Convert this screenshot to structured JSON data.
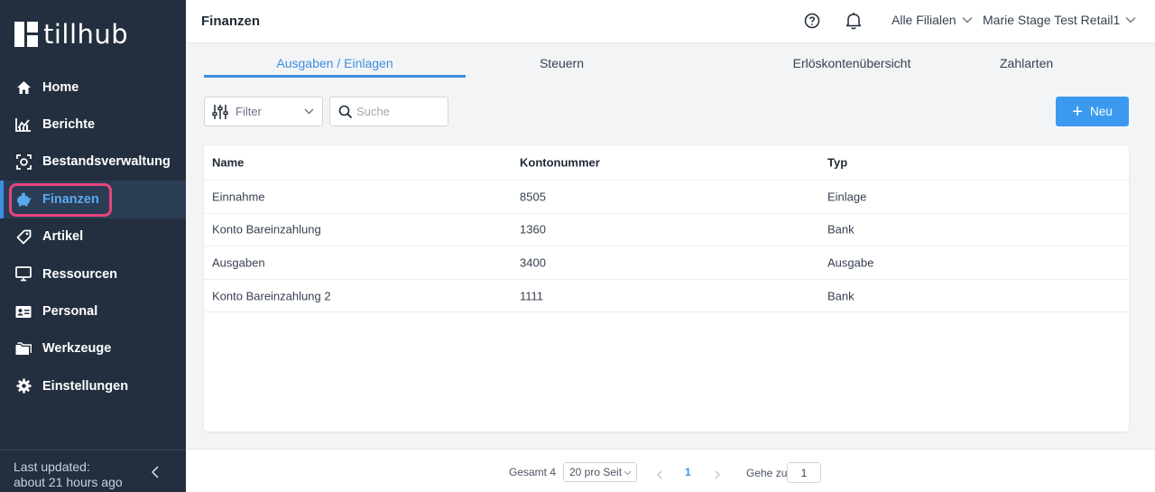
{
  "app": {
    "logo_text": "tillhub"
  },
  "sidebar": {
    "items": [
      {
        "label": "Home",
        "icon": "home-icon"
      },
      {
        "label": "Berichte",
        "icon": "chart-icon"
      },
      {
        "label": "Bestandsverwaltung",
        "icon": "inventory-icon"
      },
      {
        "label": "Finanzen",
        "icon": "piggy-bank-icon",
        "active": true
      },
      {
        "label": "Artikel",
        "icon": "tag-icon"
      },
      {
        "label": "Ressourcen",
        "icon": "monitor-icon"
      },
      {
        "label": "Personal",
        "icon": "id-card-icon"
      },
      {
        "label": "Werkzeuge",
        "icon": "folder-icon"
      },
      {
        "label": "Einstellungen",
        "icon": "gear-icon"
      }
    ],
    "footer": {
      "line1": "Last updated:",
      "line2": "about 21 hours ago"
    }
  },
  "header": {
    "title": "Finanzen",
    "branch": "Alle Filialen",
    "user": "Marie Stage Test Retail1"
  },
  "tabs": [
    {
      "label": "Ausgaben / Einlagen",
      "active": true
    },
    {
      "label": "Steuern"
    },
    {
      "label": "Erlöskontenübersicht"
    },
    {
      "label": "Zahlarten"
    }
  ],
  "toolbar": {
    "filter_label": "Filter",
    "search_placeholder": "Suche",
    "new_label": "Neu"
  },
  "table": {
    "columns": [
      "Name",
      "Kontonummer",
      "Typ"
    ],
    "rows": [
      [
        "Einnahme",
        "8505",
        "Einlage"
      ],
      [
        "Konto Bareinzahlung",
        "1360",
        "Bank"
      ],
      [
        "Ausgaben",
        "3400",
        "Ausgabe"
      ],
      [
        "Konto Bareinzahlung 2",
        "1111",
        "Bank"
      ]
    ]
  },
  "pagination": {
    "total": "Gesamt 4",
    "per_page": "20 pro Seit",
    "current_page": "1",
    "goto_label": "Gehe zu",
    "goto_value": "1"
  },
  "colors": {
    "sidebar_bg": "#232f3e",
    "accent": "#3b8fe0",
    "highlight": "#e8457a",
    "new_button": "#3b9aef"
  }
}
